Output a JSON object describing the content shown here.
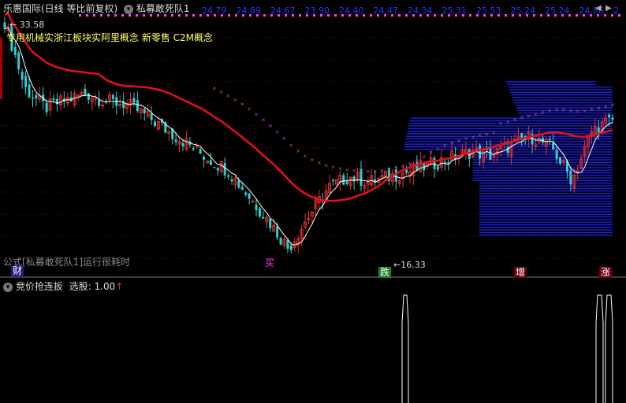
{
  "colors": {
    "background": "#000000",
    "grid": "#7a0000",
    "ma_red": "#e4101c",
    "ma_white": "#ffffff",
    "candle_up": "#e03030",
    "candle_down": "#30d0d0",
    "blue_bands": "#2020ff",
    "cross_line": "#b050d0",
    "header_yellow": "#ffff60",
    "header_purple": "#ff40ff"
  },
  "header": {
    "title": "乐惠国际(日线 等比前复权)",
    "indicator_name": "私募敢死队1",
    "values": [
      "24.79",
      "24.89",
      "24.67",
      "23.90",
      "24.40",
      "24.47",
      "24.34",
      "25.31",
      "25.53",
      "25.24",
      "25.24",
      "24.86",
      "2"
    ],
    "concepts": "专用机械实浙江板块实阿里概念 新零售 C2M概念"
  },
  "main_chart": {
    "high_label": "33.58",
    "low_label": "16.33",
    "formula_note": "公式[私募敢死队1]运行很耗时",
    "markers": {
      "cai": "财",
      "mai": "买",
      "die": "跌",
      "zeng": "增",
      "zhang": "涨"
    }
  },
  "sub_chart": {
    "indicator_name": "竞价抢连扳",
    "selector_label": "选股",
    "selector_value": "1.00",
    "arrow": "↑"
  },
  "chart_data": {
    "type": "line",
    "series": [
      {
        "name": "",
        "values": [
          33.58,
          28.5,
          27.0,
          27.6,
          28.1,
          27.5,
          27.3,
          26.4,
          25.3,
          24.3,
          23.2,
          22.3,
          20.4,
          18.5,
          16.33,
          18.8,
          21.0,
          21.8,
          21.4,
          21.8,
          22.2,
          22.7,
          23.2,
          23.7,
          23.4,
          24.2,
          24.8,
          24.0,
          21.5,
          25.3,
          26.1
        ]
      }
    ]
  },
  "nav": {
    "prev_icon": "◀",
    "next_icon": "▶"
  }
}
